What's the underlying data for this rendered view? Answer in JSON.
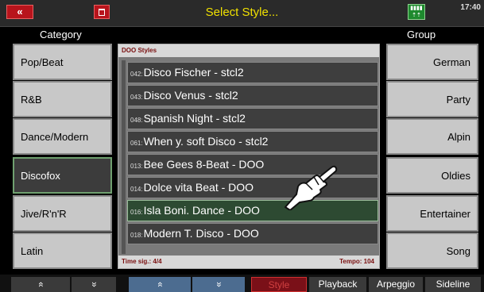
{
  "header": {
    "back_label": "«",
    "title": "Select Style...",
    "status_icon_text": "▯▯▯▯\n↑↑",
    "clock": "17:40"
  },
  "columns": {
    "category": "Category",
    "group": "Group"
  },
  "categories": [
    {
      "label": "Pop/Beat"
    },
    {
      "label": "R&B"
    },
    {
      "label": "Dance/Modern"
    },
    {
      "label": "Discofox",
      "active": true
    },
    {
      "label": "Jive/R'n'R"
    },
    {
      "label": "Latin"
    }
  ],
  "groups": [
    {
      "label": "German"
    },
    {
      "label": "Party"
    },
    {
      "label": "Alpin"
    },
    {
      "label": "Oldies"
    },
    {
      "label": "Entertainer"
    },
    {
      "label": "Song"
    }
  ],
  "list": {
    "header": "DOO Styles",
    "time_sig": "Time sig.: 4/4",
    "tempo": "Tempo: 104",
    "items": [
      {
        "num": "042:",
        "name": "Disco Fischer - stcl2"
      },
      {
        "num": "043:",
        "name": "Disco Venus - stcl2"
      },
      {
        "num": "048:",
        "name": "Spanish Night - stcl2"
      },
      {
        "num": "061:",
        "name": "When y. soft Disco - stcl2"
      },
      {
        "num": "013:",
        "name": "Bee Gees 8-Beat - DOO"
      },
      {
        "num": "014:",
        "name": "Dolce vita Beat - DOO"
      },
      {
        "num": "016:",
        "name": "Isla Boni. Dance - DOO",
        "selected": true
      },
      {
        "num": "018:",
        "name": "Modern T. Disco - DOO"
      }
    ]
  },
  "bottom": {
    "up1": "«",
    "down1": "»",
    "up2": "«",
    "down2": "»",
    "style": "Style",
    "playback": "Playback",
    "arpeggio": "Arpeggio",
    "sideline": "Sideline"
  },
  "colors": {
    "title": "#f0e000",
    "accent_red": "#b8141c",
    "selected_row": "#2d4a32"
  }
}
